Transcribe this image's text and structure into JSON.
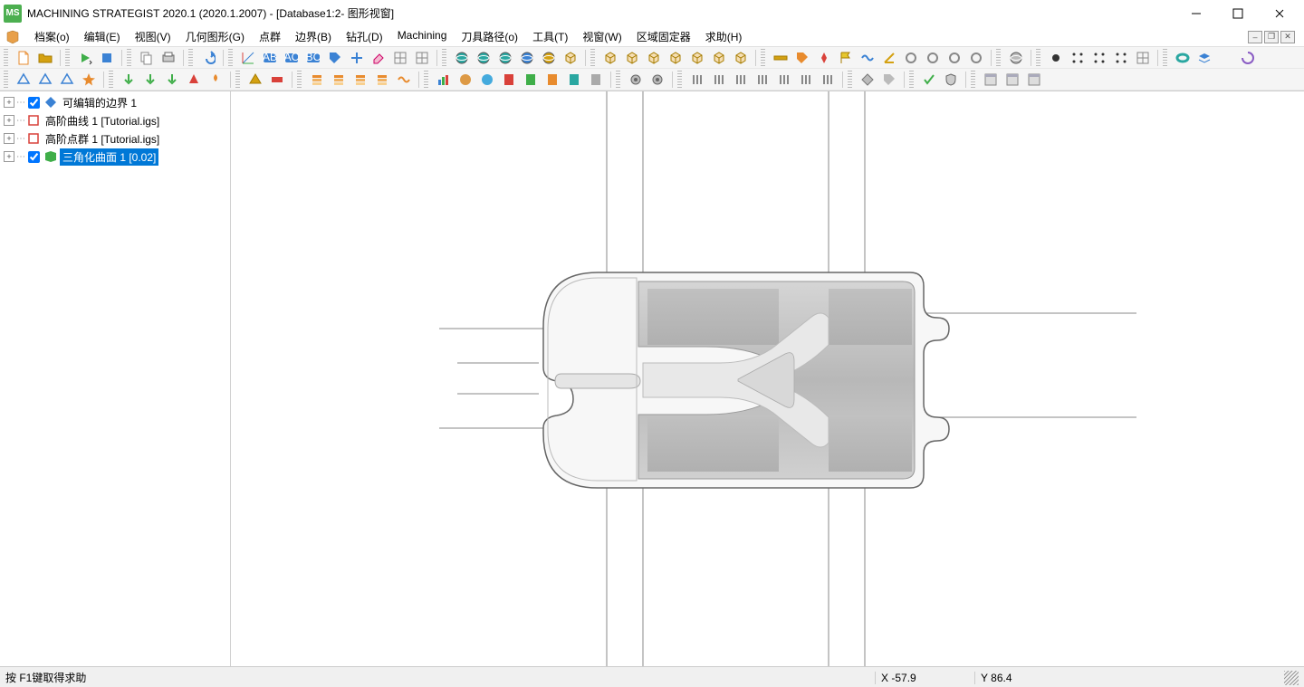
{
  "title": "MACHINING STRATEGIST 2020.1 (2020.1.2007) - [Database1:2- 图形视窗]",
  "app_icon_text": "MS",
  "menu": {
    "items": [
      "档案(o)",
      "编辑(E)",
      "视图(V)",
      "几何图形(G)",
      "点群",
      "边界(B)",
      "钻孔(D)",
      "Machining",
      "刀具路径(o)",
      "工具(T)",
      "视窗(W)",
      "区域固定器",
      "求助(H)"
    ]
  },
  "tree": {
    "items": [
      {
        "label": "可编辑的边界 1",
        "checked": true,
        "icon": "diamond-blue",
        "selected": false
      },
      {
        "label": "高阶曲线 1 [Tutorial.igs]",
        "checked": null,
        "icon": "curve-orange",
        "selected": false
      },
      {
        "label": "高阶点群 1 [Tutorial.igs]",
        "checked": null,
        "icon": "points-orange",
        "selected": false
      },
      {
        "label": "三角化曲面 1 [0.02]",
        "checked": true,
        "icon": "surface-green",
        "selected": true
      }
    ]
  },
  "status": {
    "help": "按 F1键取得求助",
    "x_label": "X",
    "x_value": "-57.9",
    "y_label": "Y",
    "y_value": "86.4"
  },
  "toolbar_icons_row1": [
    "new-file",
    "open-file",
    "sep",
    "run-dropdown",
    "stop",
    "sep",
    "copy",
    "print",
    "sep",
    "undo",
    "sep",
    "axis",
    "label-ab",
    "label-ac",
    "label-bc",
    "tag-blue",
    "cross-blue",
    "eraser",
    "grid-small",
    "grid-large",
    "sep",
    "globe",
    "sphere1",
    "sphere2",
    "globe-blue",
    "globe-gold",
    "cube-net",
    "sep",
    "cube1",
    "cube2",
    "cube3",
    "cube4",
    "cube5",
    "cube6",
    "cube7",
    "sep",
    "ruler",
    "tag",
    "pin",
    "flag-yellow",
    "wave",
    "angle",
    "circle1",
    "circle2",
    "circle3",
    "circle4",
    "sep",
    "sphere-gray",
    "sep",
    "dot-solid",
    "dots-h",
    "dots-square",
    "dots-grid",
    "grid-dots",
    "sep",
    "torus",
    "layers",
    "gradient",
    "swirl"
  ],
  "toolbar_icons_row2": [
    "poly1",
    "poly2",
    "poly3",
    "star-tool",
    "sep",
    "arrow-down1",
    "arrow-down2",
    "arrow-down3",
    "cone-red",
    "flame",
    "sep",
    "pyramid",
    "brick-red",
    "sep",
    "layer1",
    "layer2",
    "layer3",
    "stack-orange",
    "wave-orange",
    "sep",
    "chart",
    "circ-a",
    "circ-b",
    "col-red",
    "col-green",
    "col-orange",
    "col-teal",
    "col-gray",
    "sep",
    "gear1",
    "gear2",
    "sep",
    "bars1",
    "bars2",
    "bars3",
    "bars4",
    "bars5",
    "bars6",
    "bars7",
    "sep",
    "diamond-gray",
    "tag-gray",
    "sep",
    "check",
    "shield",
    "sep",
    "panel1",
    "panel2",
    "panel3"
  ]
}
